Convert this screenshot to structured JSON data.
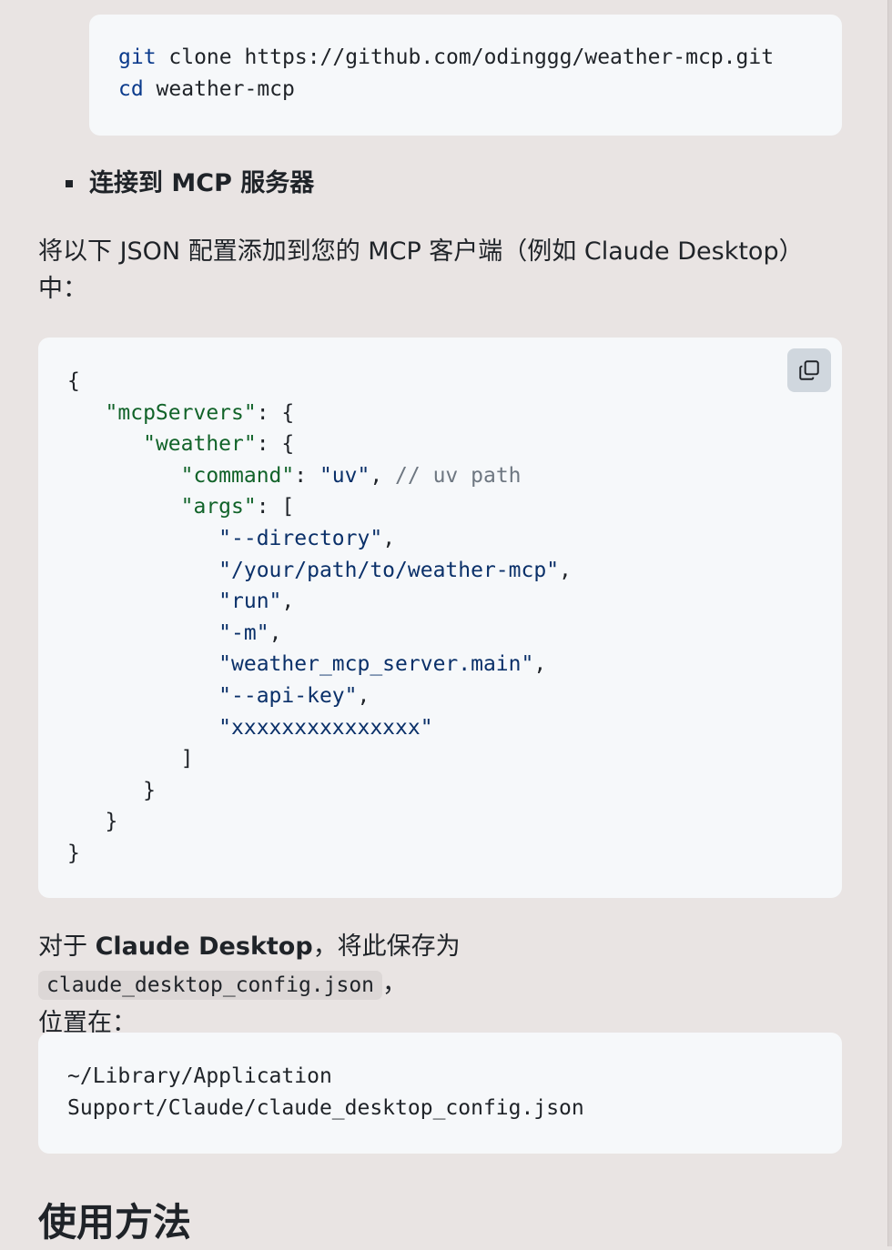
{
  "git_block": {
    "line1": {
      "kw": "git",
      "rest": " clone https://github.com/odinggg/weather-mcp.git"
    },
    "line2": {
      "kw": "cd",
      "rest": " weather-mcp"
    }
  },
  "bullet": {
    "label": "连接到 MCP 服务器"
  },
  "paragraph1": {
    "text": "将以下 JSON 配置添加到您的 MCP 客户端（例如 Claude Desktop）中："
  },
  "json_block": {
    "copy_icon": "copy-icon",
    "open_brace": "{",
    "mcp_key": "\"mcpServers\"",
    "weather_key": "\"weather\"",
    "command_key": "\"command\"",
    "command_val": "\"uv\"",
    "command_comment": "// uv path",
    "args_key": "\"args\"",
    "args": [
      "\"--directory\"",
      "\"/your/path/to/weather-mcp\"",
      "\"run\"",
      "\"-m\"",
      "\"weather_mcp_server.main\"",
      "\"--api-key\"",
      "\"xxxxxxxxxxxxxxx\""
    ],
    "close_bracket": "]",
    "close_brace": "}"
  },
  "paragraph2": {
    "prefix": "对于 ",
    "bold": "Claude Desktop",
    "middle": "，将此保存为 ",
    "code": "claude_desktop_config.json",
    "suffix": "，",
    "line2": "位置在："
  },
  "path_block": {
    "line1": "~/Library/Application",
    "line2": "Support/Claude/claude_desktop_config.json"
  },
  "section_heading": {
    "text": "使用方法"
  }
}
